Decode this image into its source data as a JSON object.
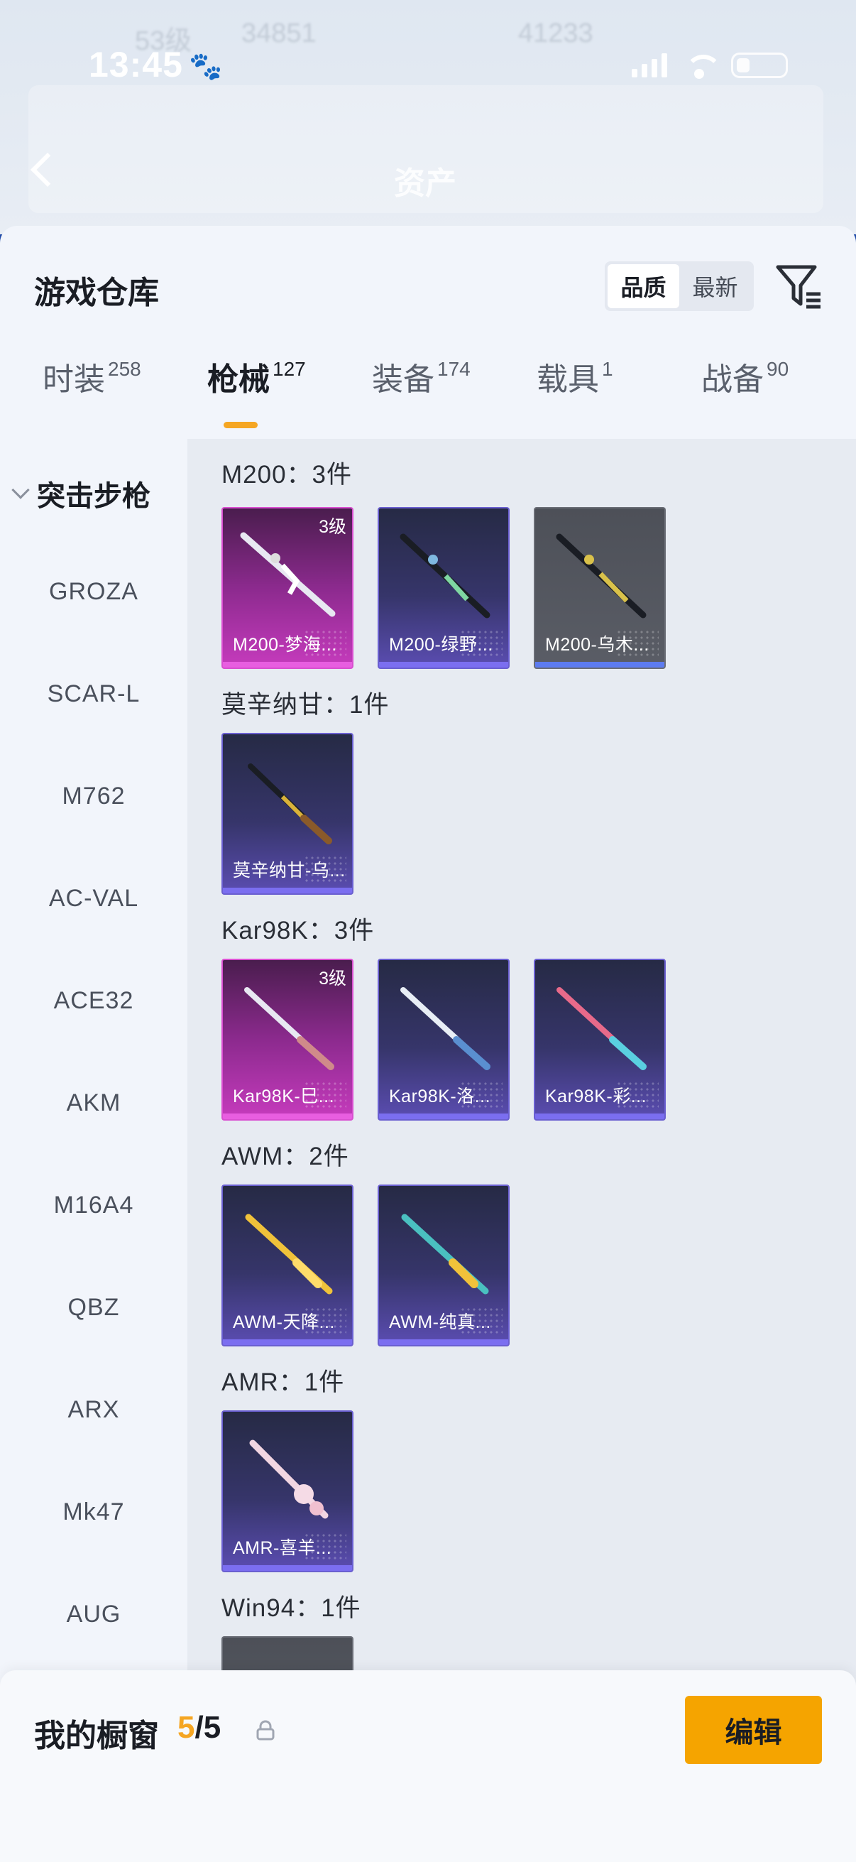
{
  "status_bar": {
    "time": "13:45",
    "paw_icon": "paw-icon"
  },
  "background": {
    "title": "资产",
    "ghost_texts": [
      "53级",
      "34851",
      "41233"
    ]
  },
  "header": {
    "title": "游戏仓库",
    "sort_options": [
      "品质",
      "最新"
    ],
    "active_sort": "品质"
  },
  "tabs": [
    {
      "label": "时装",
      "count": "258"
    },
    {
      "label": "枪械",
      "count": "127"
    },
    {
      "label": "装备",
      "count": "174"
    },
    {
      "label": "载具",
      "count": "1"
    },
    {
      "label": "战备",
      "count": "90"
    }
  ],
  "active_tab": "枪械",
  "sidebar": {
    "category": "突击步枪",
    "items": [
      "GROZA",
      "SCAR-L",
      "M762",
      "AC-VAL",
      "ACE32",
      "AKM",
      "M16A4",
      "QBZ",
      "ARX",
      "Mk47",
      "AUG"
    ]
  },
  "groups": [
    {
      "title": "M200：3件",
      "items": [
        {
          "name": "M200-梦海...",
          "level": "3级",
          "rarity": "pink"
        },
        {
          "name": "M200-绿野...",
          "level": "",
          "rarity": "blue"
        },
        {
          "name": "M200-乌木...",
          "level": "",
          "rarity": "gray"
        }
      ]
    },
    {
      "title": "莫辛纳甘：1件",
      "items": [
        {
          "name": "莫辛纳甘-乌...",
          "level": "",
          "rarity": "blue"
        }
      ]
    },
    {
      "title": "Kar98K：3件",
      "items": [
        {
          "name": "Kar98K-巳...",
          "level": "3级",
          "rarity": "pink"
        },
        {
          "name": "Kar98K-洛...",
          "level": "",
          "rarity": "blue"
        },
        {
          "name": "Kar98K-彩...",
          "level": "",
          "rarity": "blue"
        }
      ]
    },
    {
      "title": "AWM：2件",
      "items": [
        {
          "name": "AWM-天降...",
          "level": "",
          "rarity": "blue"
        },
        {
          "name": "AWM-纯真...",
          "level": "",
          "rarity": "blue"
        }
      ]
    },
    {
      "title": "AMR：1件",
      "items": [
        {
          "name": "AMR-喜羊...",
          "level": "",
          "rarity": "blue"
        }
      ]
    },
    {
      "title": "Win94：1件",
      "items": []
    }
  ],
  "showcase": {
    "label": "我的橱窗",
    "current": "5",
    "total": "/5",
    "edit_label": "编辑"
  },
  "colors": {
    "accent": "#f5a623",
    "pink_card": "#c63bbd",
    "blue_card": "#5b4db2",
    "gray_card": "#5a5d66"
  }
}
